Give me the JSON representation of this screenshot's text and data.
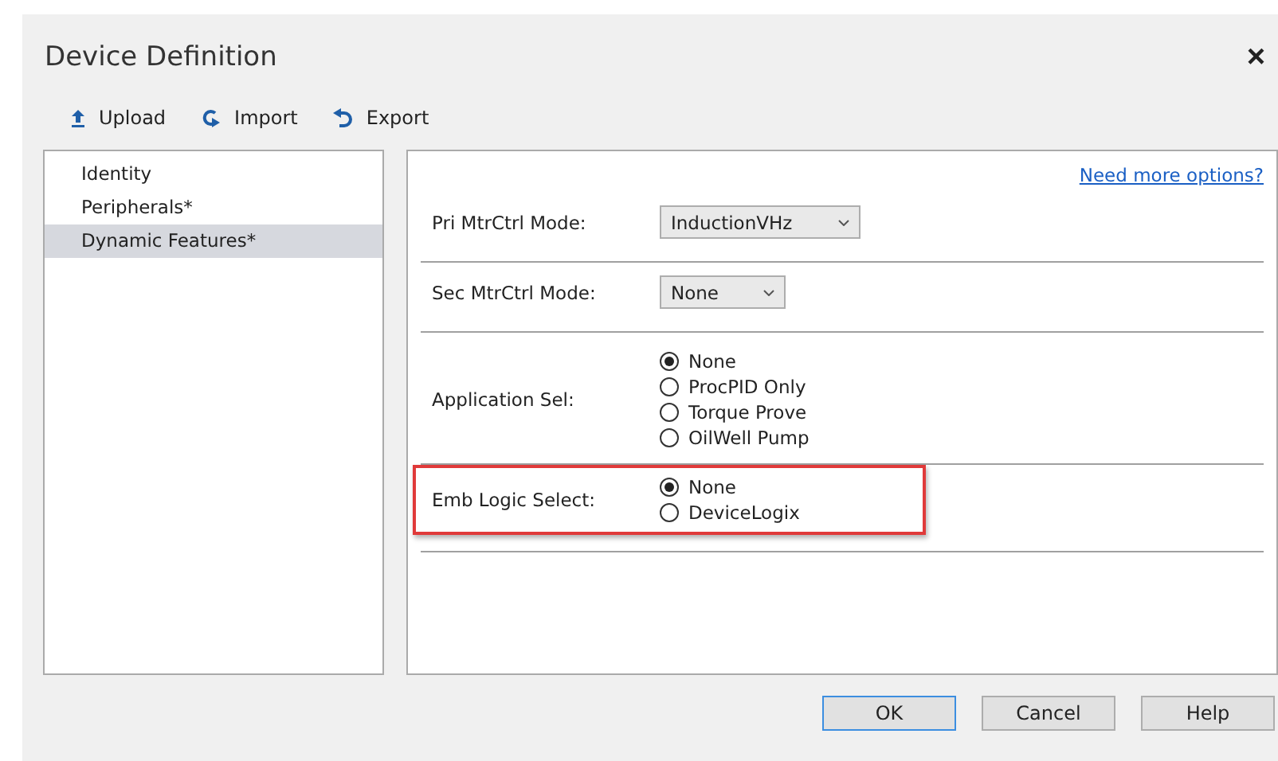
{
  "window": {
    "title": "Device Definition",
    "close": "×"
  },
  "toolbar": [
    {
      "kind": "upload",
      "label": "Upload"
    },
    {
      "kind": "import",
      "label": "Import"
    },
    {
      "kind": "export",
      "label": "Export"
    }
  ],
  "sidebar": {
    "items": [
      {
        "label": "Identity",
        "selected": false
      },
      {
        "label": "Peripherals*",
        "selected": false
      },
      {
        "label": "Dynamic Features*",
        "selected": true
      }
    ]
  },
  "link": "Need more options?",
  "sections": [
    {
      "kind": "dropdown",
      "label": "Pri MtrCtrl Mode:",
      "value": "InductionVHz",
      "highlighted": false
    },
    {
      "kind": "dropdown",
      "label": "Sec MtrCtrl Mode:",
      "value": "None",
      "highlighted": false
    },
    {
      "kind": "radio",
      "label": "Application Sel:",
      "highlighted": false,
      "options": [
        {
          "label": "None",
          "selected": true
        },
        {
          "label": "ProcPID Only",
          "selected": false
        },
        {
          "label": "Torque Prove",
          "selected": false
        },
        {
          "label": "OilWell Pump",
          "selected": false
        }
      ]
    },
    {
      "kind": "radio",
      "label": "Emb Logic Select:",
      "highlighted": true,
      "options": [
        {
          "label": "None",
          "selected": true
        },
        {
          "label": "DeviceLogix",
          "selected": false
        }
      ]
    }
  ],
  "buttons": [
    {
      "label": "OK",
      "default": true
    },
    {
      "label": "Cancel",
      "default": false
    },
    {
      "label": "Help",
      "default": false
    }
  ]
}
